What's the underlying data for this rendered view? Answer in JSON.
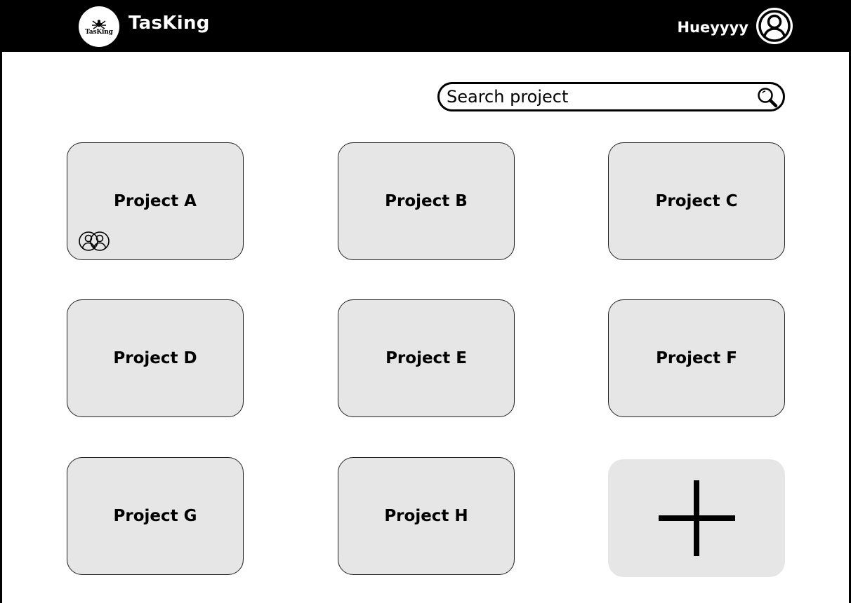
{
  "header": {
    "app_title": "TasKing",
    "logo_text": "TasKing",
    "username": "Hueyyyy"
  },
  "search": {
    "placeholder": "Search project"
  },
  "projects": [
    {
      "label": "Project A",
      "shared": true
    },
    {
      "label": "Project B",
      "shared": false
    },
    {
      "label": "Project C",
      "shared": false
    },
    {
      "label": "Project D",
      "shared": false
    },
    {
      "label": "Project E",
      "shared": false
    },
    {
      "label": "Project F",
      "shared": false
    },
    {
      "label": "Project G",
      "shared": false
    },
    {
      "label": "Project H",
      "shared": false
    }
  ],
  "icons": {
    "logo": "crown-spider-logo",
    "avatar": "user-icon",
    "search": "search-icon",
    "members": "group-icon",
    "add": "plus-icon"
  },
  "colors": {
    "header_bg": "#000000",
    "card_bg": "#e6e6e6",
    "text": "#000000"
  }
}
